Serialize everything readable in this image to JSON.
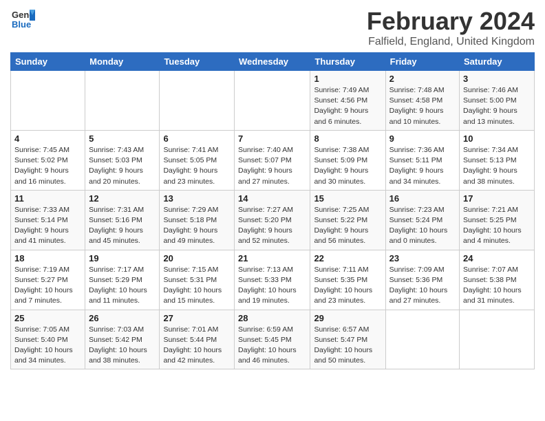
{
  "header": {
    "logo_general": "General",
    "logo_blue": "Blue",
    "month_year": "February 2024",
    "location": "Falfield, England, United Kingdom"
  },
  "days_of_week": [
    "Sunday",
    "Monday",
    "Tuesday",
    "Wednesday",
    "Thursday",
    "Friday",
    "Saturday"
  ],
  "weeks": [
    [
      {
        "day": "",
        "info": ""
      },
      {
        "day": "",
        "info": ""
      },
      {
        "day": "",
        "info": ""
      },
      {
        "day": "",
        "info": ""
      },
      {
        "day": "1",
        "info": "Sunrise: 7:49 AM\nSunset: 4:56 PM\nDaylight: 9 hours\nand 6 minutes."
      },
      {
        "day": "2",
        "info": "Sunrise: 7:48 AM\nSunset: 4:58 PM\nDaylight: 9 hours\nand 10 minutes."
      },
      {
        "day": "3",
        "info": "Sunrise: 7:46 AM\nSunset: 5:00 PM\nDaylight: 9 hours\nand 13 minutes."
      }
    ],
    [
      {
        "day": "4",
        "info": "Sunrise: 7:45 AM\nSunset: 5:02 PM\nDaylight: 9 hours\nand 16 minutes."
      },
      {
        "day": "5",
        "info": "Sunrise: 7:43 AM\nSunset: 5:03 PM\nDaylight: 9 hours\nand 20 minutes."
      },
      {
        "day": "6",
        "info": "Sunrise: 7:41 AM\nSunset: 5:05 PM\nDaylight: 9 hours\nand 23 minutes."
      },
      {
        "day": "7",
        "info": "Sunrise: 7:40 AM\nSunset: 5:07 PM\nDaylight: 9 hours\nand 27 minutes."
      },
      {
        "day": "8",
        "info": "Sunrise: 7:38 AM\nSunset: 5:09 PM\nDaylight: 9 hours\nand 30 minutes."
      },
      {
        "day": "9",
        "info": "Sunrise: 7:36 AM\nSunset: 5:11 PM\nDaylight: 9 hours\nand 34 minutes."
      },
      {
        "day": "10",
        "info": "Sunrise: 7:34 AM\nSunset: 5:13 PM\nDaylight: 9 hours\nand 38 minutes."
      }
    ],
    [
      {
        "day": "11",
        "info": "Sunrise: 7:33 AM\nSunset: 5:14 PM\nDaylight: 9 hours\nand 41 minutes."
      },
      {
        "day": "12",
        "info": "Sunrise: 7:31 AM\nSunset: 5:16 PM\nDaylight: 9 hours\nand 45 minutes."
      },
      {
        "day": "13",
        "info": "Sunrise: 7:29 AM\nSunset: 5:18 PM\nDaylight: 9 hours\nand 49 minutes."
      },
      {
        "day": "14",
        "info": "Sunrise: 7:27 AM\nSunset: 5:20 PM\nDaylight: 9 hours\nand 52 minutes."
      },
      {
        "day": "15",
        "info": "Sunrise: 7:25 AM\nSunset: 5:22 PM\nDaylight: 9 hours\nand 56 minutes."
      },
      {
        "day": "16",
        "info": "Sunrise: 7:23 AM\nSunset: 5:24 PM\nDaylight: 10 hours\nand 0 minutes."
      },
      {
        "day": "17",
        "info": "Sunrise: 7:21 AM\nSunset: 5:25 PM\nDaylight: 10 hours\nand 4 minutes."
      }
    ],
    [
      {
        "day": "18",
        "info": "Sunrise: 7:19 AM\nSunset: 5:27 PM\nDaylight: 10 hours\nand 7 minutes."
      },
      {
        "day": "19",
        "info": "Sunrise: 7:17 AM\nSunset: 5:29 PM\nDaylight: 10 hours\nand 11 minutes."
      },
      {
        "day": "20",
        "info": "Sunrise: 7:15 AM\nSunset: 5:31 PM\nDaylight: 10 hours\nand 15 minutes."
      },
      {
        "day": "21",
        "info": "Sunrise: 7:13 AM\nSunset: 5:33 PM\nDaylight: 10 hours\nand 19 minutes."
      },
      {
        "day": "22",
        "info": "Sunrise: 7:11 AM\nSunset: 5:35 PM\nDaylight: 10 hours\nand 23 minutes."
      },
      {
        "day": "23",
        "info": "Sunrise: 7:09 AM\nSunset: 5:36 PM\nDaylight: 10 hours\nand 27 minutes."
      },
      {
        "day": "24",
        "info": "Sunrise: 7:07 AM\nSunset: 5:38 PM\nDaylight: 10 hours\nand 31 minutes."
      }
    ],
    [
      {
        "day": "25",
        "info": "Sunrise: 7:05 AM\nSunset: 5:40 PM\nDaylight: 10 hours\nand 34 minutes."
      },
      {
        "day": "26",
        "info": "Sunrise: 7:03 AM\nSunset: 5:42 PM\nDaylight: 10 hours\nand 38 minutes."
      },
      {
        "day": "27",
        "info": "Sunrise: 7:01 AM\nSunset: 5:44 PM\nDaylight: 10 hours\nand 42 minutes."
      },
      {
        "day": "28",
        "info": "Sunrise: 6:59 AM\nSunset: 5:45 PM\nDaylight: 10 hours\nand 46 minutes."
      },
      {
        "day": "29",
        "info": "Sunrise: 6:57 AM\nSunset: 5:47 PM\nDaylight: 10 hours\nand 50 minutes."
      },
      {
        "day": "",
        "info": ""
      },
      {
        "day": "",
        "info": ""
      }
    ]
  ]
}
